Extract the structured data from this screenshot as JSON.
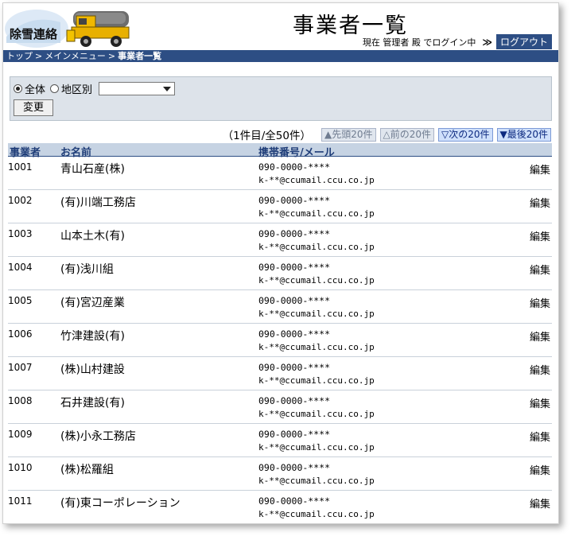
{
  "header": {
    "logo_text": "除雪連絡",
    "page_title": "事業者一覧",
    "user_line": "現在 管理者 殿 でログイン中",
    "logout_label": "ログアウト"
  },
  "breadcrumb": {
    "items": [
      "トップ",
      "メインメニュー",
      "事業者一覧"
    ]
  },
  "filter": {
    "all_label": "全体",
    "region_label": "地区別",
    "region_selected": "",
    "change_label": "変更"
  },
  "pager": {
    "count_text": "（1件目/全50件）",
    "first_label": "▲先頭20件",
    "prev_label": "△前の20件",
    "next_label": "▽次の20件",
    "last_label": "▼最後20件"
  },
  "table": {
    "headers": {
      "code": "事業者",
      "name": "お名前",
      "contact": "携帯番号/メール"
    },
    "edit_label": "編集",
    "rows": [
      {
        "code": "1001",
        "name": "青山石産(株)",
        "phone": "090-0000-****",
        "mail": "k-**@ccumail.ccu.co.jp"
      },
      {
        "code": "1002",
        "name": "(有)川端工務店",
        "phone": "090-0000-****",
        "mail": "k-**@ccumail.ccu.co.jp"
      },
      {
        "code": "1003",
        "name": "山本土木(有)",
        "phone": "090-0000-****",
        "mail": "k-**@ccumail.ccu.co.jp"
      },
      {
        "code": "1004",
        "name": "(有)浅川組",
        "phone": "090-0000-****",
        "mail": "k-**@ccumail.ccu.co.jp"
      },
      {
        "code": "1005",
        "name": "(有)宮辺産業",
        "phone": "090-0000-****",
        "mail": "k-**@ccumail.ccu.co.jp"
      },
      {
        "code": "1006",
        "name": "竹津建設(有)",
        "phone": "090-0000-****",
        "mail": "k-**@ccumail.ccu.co.jp"
      },
      {
        "code": "1007",
        "name": "(株)山村建設",
        "phone": "090-0000-****",
        "mail": "k-**@ccumail.ccu.co.jp"
      },
      {
        "code": "1008",
        "name": "石井建設(有)",
        "phone": "090-0000-****",
        "mail": "k-**@ccumail.ccu.co.jp"
      },
      {
        "code": "1009",
        "name": "(株)小永工務店",
        "phone": "090-0000-****",
        "mail": "k-**@ccumail.ccu.co.jp"
      },
      {
        "code": "1010",
        "name": "(株)松羅組",
        "phone": "090-0000-****",
        "mail": "k-**@ccumail.ccu.co.jp"
      },
      {
        "code": "1011",
        "name": "(有)東コーポレーション",
        "phone": "090-0000-****",
        "mail": "k-**@ccumail.ccu.co.jp"
      }
    ]
  },
  "colors": {
    "brand_navy": "#2d4e84",
    "header_row": "#c6d3e3",
    "filter_bg": "#dde3ea"
  },
  "icons": {
    "logo": "snowplow-truck-icon"
  }
}
